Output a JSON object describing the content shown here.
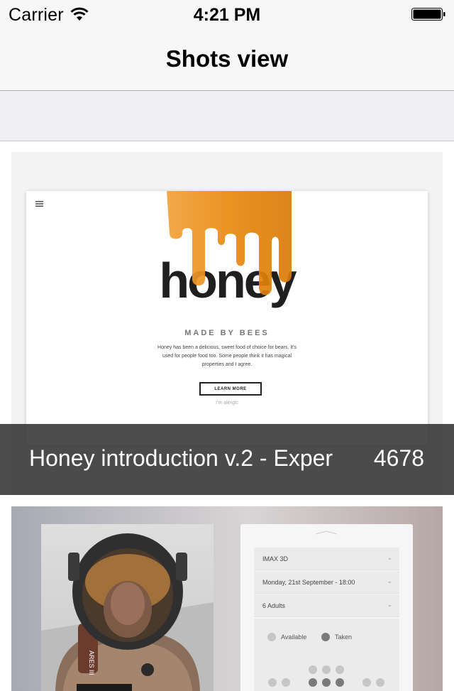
{
  "status_bar": {
    "carrier": "Carrier",
    "time": "4:21 PM",
    "wifi_icon": "wifi-icon",
    "battery_icon": "battery-icon"
  },
  "nav": {
    "title": "Shots view"
  },
  "shots": [
    {
      "caption": "Honey introduction v.2 - Exper",
      "count": "4678",
      "mock": {
        "headline": "honey",
        "tagline": "MADE BY BEES",
        "description": "Honey has been a delicious, sweet food of choice for bears. It's used for people food too. Some people think it has magical properties and I agree.",
        "button": "LEARN MORE",
        "link": "I'm alergic"
      }
    },
    {
      "mock": {
        "rows": [
          "IMAX 3D",
          "Monday, 21st September - 18:00",
          "6 Adults"
        ],
        "legend": [
          "Available",
          "Taken"
        ],
        "poster_text": "ARES III"
      }
    }
  ],
  "colors": {
    "nav_bg": "#f7f7f7",
    "caption_bg": "#333333",
    "honey": "#e8890f"
  }
}
